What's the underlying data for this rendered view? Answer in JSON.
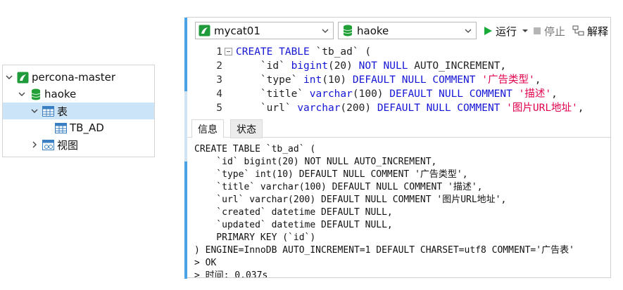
{
  "tree": {
    "items": [
      {
        "label": "percona-master",
        "icon": "connection-icon",
        "expanded": true
      },
      {
        "label": "haoke",
        "icon": "database-icon",
        "expanded": true
      },
      {
        "label": "表",
        "icon": "table-group-icon",
        "expanded": true,
        "selected": true
      },
      {
        "label": "TB_AD",
        "icon": "table-icon"
      },
      {
        "label": "视图",
        "icon": "view-group-icon",
        "expanded": false
      }
    ]
  },
  "toolbar": {
    "connection": "mycat01",
    "database": "haoke",
    "run_label": "运行",
    "stop_label": "停止",
    "explain_label": "解释"
  },
  "editor": {
    "lines": [
      {
        "n": "1",
        "parts": [
          {
            "t": "CREATE TABLE ",
            "c": "kw"
          },
          {
            "t": "`tb_ad` (",
            "c": ""
          }
        ]
      },
      {
        "n": "2",
        "parts": [
          {
            "t": "    `id` ",
            "c": ""
          },
          {
            "t": "bigint",
            "c": "kw"
          },
          {
            "t": "(20) ",
            "c": ""
          },
          {
            "t": "NOT NULL ",
            "c": "kw"
          },
          {
            "t": "AUTO_INCREMENT,",
            "c": ""
          }
        ]
      },
      {
        "n": "3",
        "parts": [
          {
            "t": "    `type` ",
            "c": ""
          },
          {
            "t": "int",
            "c": "kw"
          },
          {
            "t": "(10) ",
            "c": ""
          },
          {
            "t": "DEFAULT NULL COMMENT ",
            "c": "kw"
          },
          {
            "t": "'广告类型'",
            "c": "str"
          },
          {
            "t": ",",
            "c": ""
          }
        ]
      },
      {
        "n": "4",
        "parts": [
          {
            "t": "    `title` ",
            "c": ""
          },
          {
            "t": "varchar",
            "c": "kw"
          },
          {
            "t": "(100) ",
            "c": ""
          },
          {
            "t": "DEFAULT NULL COMMENT ",
            "c": "kw"
          },
          {
            "t": "'描述'",
            "c": "str"
          },
          {
            "t": ",",
            "c": ""
          }
        ]
      },
      {
        "n": "5",
        "parts": [
          {
            "t": "    `url` ",
            "c": ""
          },
          {
            "t": "varchar",
            "c": "kw"
          },
          {
            "t": "(200) ",
            "c": ""
          },
          {
            "t": "DEFAULT NULL COMMENT ",
            "c": "kw"
          },
          {
            "t": "'图片URL地址'",
            "c": "str"
          },
          {
            "t": ",",
            "c": ""
          }
        ]
      }
    ]
  },
  "tabs": [
    {
      "label": "信息",
      "active": true
    },
    {
      "label": "状态",
      "active": false
    }
  ],
  "output": {
    "lines": [
      "CREATE TABLE `tb_ad` (",
      "    `id` bigint(20) NOT NULL AUTO_INCREMENT,",
      "    `type` int(10) DEFAULT NULL COMMENT '广告类型',",
      "    `title` varchar(100) DEFAULT NULL COMMENT '描述',",
      "    `url` varchar(200) DEFAULT NULL COMMENT '图片URL地址',",
      "    `created` datetime DEFAULT NULL,",
      "    `updated` datetime DEFAULT NULL,",
      "    PRIMARY KEY (`id`)",
      ") ENGINE=InnoDB AUTO_INCREMENT=1 DEFAULT CHARSET=utf8 COMMENT='广告表'",
      "> OK",
      "> 时间: 0.037s"
    ]
  },
  "colors": {
    "keyword": "#1515d6",
    "string": "#e0004c",
    "selection": "#cce4f7",
    "accent": "#4ba3e6",
    "run_green": "#1aaa3a",
    "db_green": "#21a038"
  }
}
